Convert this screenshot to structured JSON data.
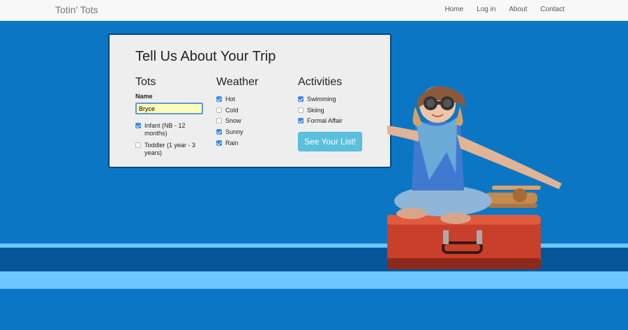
{
  "navbar": {
    "brand": "Totin' Tots",
    "links": [
      "Home",
      "Log in",
      "About",
      "Contact"
    ]
  },
  "form": {
    "title": "Tell Us About Your Trip",
    "tots": {
      "heading": "Tots",
      "name_label": "Name",
      "name_value": "Bryce",
      "options": [
        {
          "line1": "Infant (NB - 12",
          "line2": "months)",
          "checked": true
        },
        {
          "line1": "Toddler (1 year - 3",
          "line2": "years)",
          "checked": false
        }
      ]
    },
    "weather": {
      "heading": "Weather",
      "options": [
        {
          "label": "Hot",
          "checked": true
        },
        {
          "label": "Cold",
          "checked": false
        },
        {
          "label": "Snow",
          "checked": false
        },
        {
          "label": "Sunny",
          "checked": true
        },
        {
          "label": "Rain",
          "checked": true
        }
      ]
    },
    "activities": {
      "heading": "Activities",
      "options": [
        {
          "label": "Swimming",
          "checked": true
        },
        {
          "label": "Skiing",
          "checked": false
        },
        {
          "label": "Formal Affair",
          "checked": true
        }
      ]
    },
    "submit_label": "See Your List!"
  },
  "colors": {
    "background": "#0b77c4",
    "stripe_light": "#6cc6ff",
    "stripe_dark": "#07569a",
    "button": "#5bc0de",
    "checkbox": "#3b8be0"
  },
  "hero_image": "child-on-suitcase-illustration"
}
